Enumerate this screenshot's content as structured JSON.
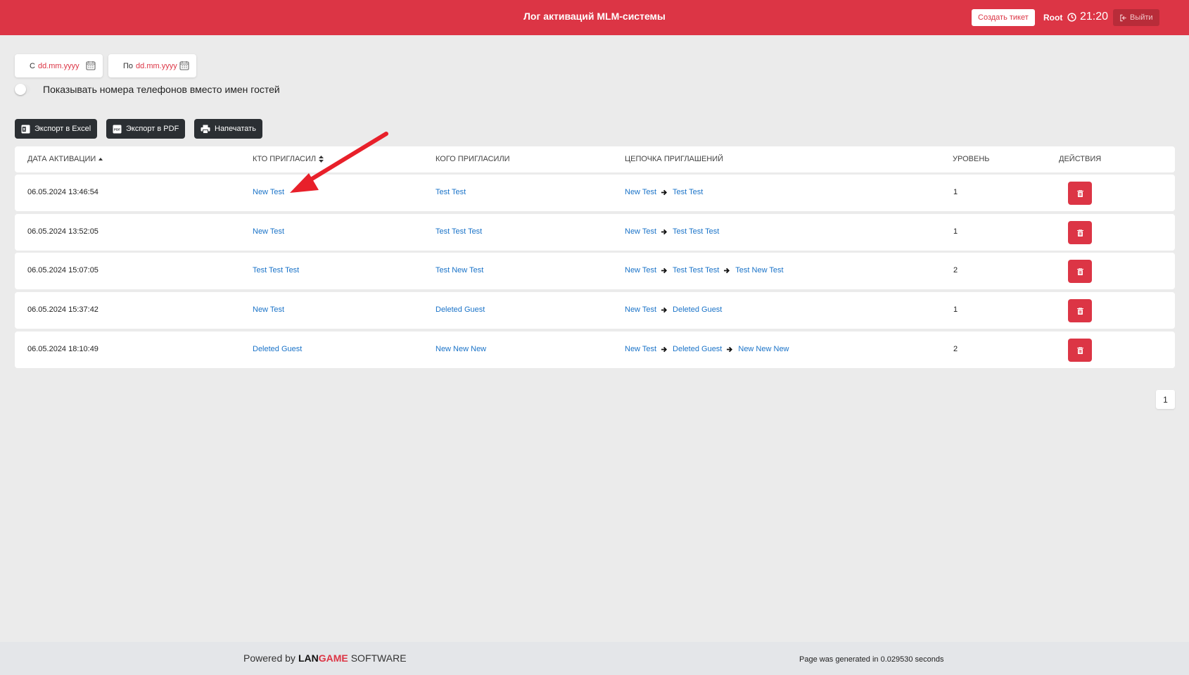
{
  "header": {
    "title": "Лог активаций MLM-системы",
    "ticket_label": "Создать тикет",
    "user": "Root",
    "time": "21:20",
    "logout_label": "Выйти"
  },
  "filters": {
    "from_label": "С",
    "from_value": "dd.mm.yyyy",
    "to_label": "По",
    "to_value": "dd.mm.yyyy",
    "toggle_label": "Показывать номера телефонов вместо имен гостей",
    "toggle_on": false
  },
  "export": {
    "excel_label": "Экспорт в Excel",
    "pdf_label": "Экспорт в PDF",
    "print_label": "Напечатать"
  },
  "table": {
    "columns": [
      "ДАТА АКТИВАЦИИ",
      "КТО ПРИГЛАСИЛ",
      "КОГО ПРИГЛАСИЛИ",
      "ЦЕПОЧКА ПРИГЛАШЕНИЙ",
      "УРОВЕНЬ",
      "ДЕЙСТВИЯ"
    ],
    "rows": [
      {
        "date": "06.05.2024 13:46:54",
        "inviter": "New Test",
        "invitee": "Test Test",
        "chain": [
          "New Test",
          "Test Test"
        ],
        "level": "1"
      },
      {
        "date": "06.05.2024 13:52:05",
        "inviter": "New Test",
        "invitee": "Test Test Test",
        "chain": [
          "New Test",
          "Test Test Test"
        ],
        "level": "1"
      },
      {
        "date": "06.05.2024 15:07:05",
        "inviter": "Test Test Test",
        "invitee": "Test New Test",
        "chain": [
          "New Test",
          "Test Test Test",
          "Test New Test"
        ],
        "level": "2"
      },
      {
        "date": "06.05.2024 15:37:42",
        "inviter": "New Test",
        "invitee": "Deleted Guest",
        "chain": [
          "New Test",
          "Deleted Guest"
        ],
        "level": "1"
      },
      {
        "date": "06.05.2024 18:10:49",
        "inviter": "Deleted Guest",
        "invitee": "New New New",
        "chain": [
          "New Test",
          "Deleted Guest",
          "New New New"
        ],
        "level": "2"
      }
    ]
  },
  "pagination": {
    "current": "1"
  },
  "footer": {
    "powered_prefix": "Powered by",
    "brand_lan": "LAN",
    "brand_game": "GAME",
    "brand_suffix": "SOFTWARE",
    "generated": "Page was generated in 0.029530 seconds"
  },
  "colors": {
    "accent": "#dc3545",
    "link": "#1a73c8",
    "dark_button": "#2b2f33",
    "background": "#ebebeb"
  },
  "icons": {
    "clock": "clock-icon",
    "logout": "logout-icon",
    "calendar": "calendar-icon",
    "excel": "excel-icon",
    "pdf": "pdf-icon",
    "print": "printer-icon",
    "sort": "sort-icon",
    "chain_arrow": "arrow-right-icon",
    "delete": "trash-icon",
    "annotation": "red-annotation-arrow"
  }
}
